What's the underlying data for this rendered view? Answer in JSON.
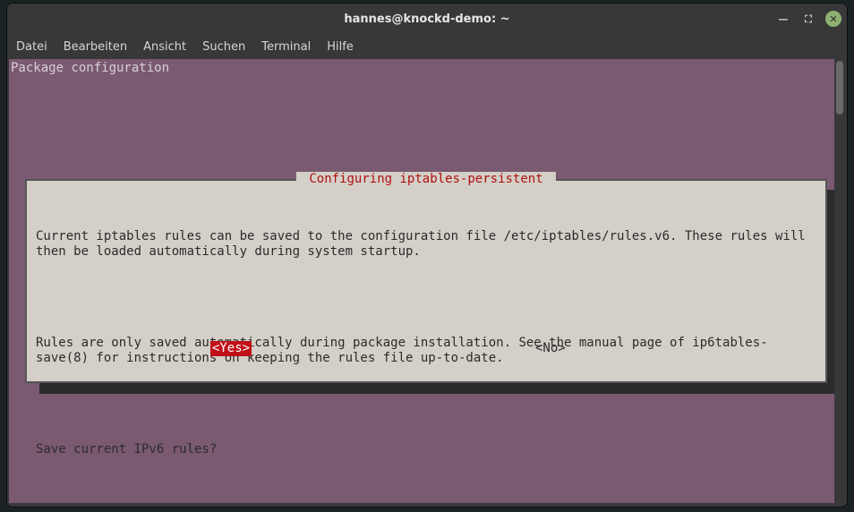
{
  "window": {
    "title": "hannes@knockd-demo: ~"
  },
  "menu": {
    "file": "Datei",
    "edit": "Bearbeiten",
    "view": "Ansicht",
    "search": "Suchen",
    "terminal": "Terminal",
    "help": "Hilfe"
  },
  "terminal": {
    "header": "Package configuration"
  },
  "dialog": {
    "title": " Configuring iptables-persistent ",
    "para1": "Current iptables rules can be saved to the configuration file /etc/iptables/rules.v6. These rules will then be loaded automatically during system startup.",
    "para2": "Rules are only saved automatically during package installation. See the manual page of ip6tables-save(8) for instructions on keeping the rules file up-to-date.",
    "question": "Save current IPv6 rules?",
    "yes": "<Yes>",
    "no": "<No>"
  },
  "winbuttons": {
    "min": "—",
    "max": "⛶",
    "close": "✕"
  }
}
